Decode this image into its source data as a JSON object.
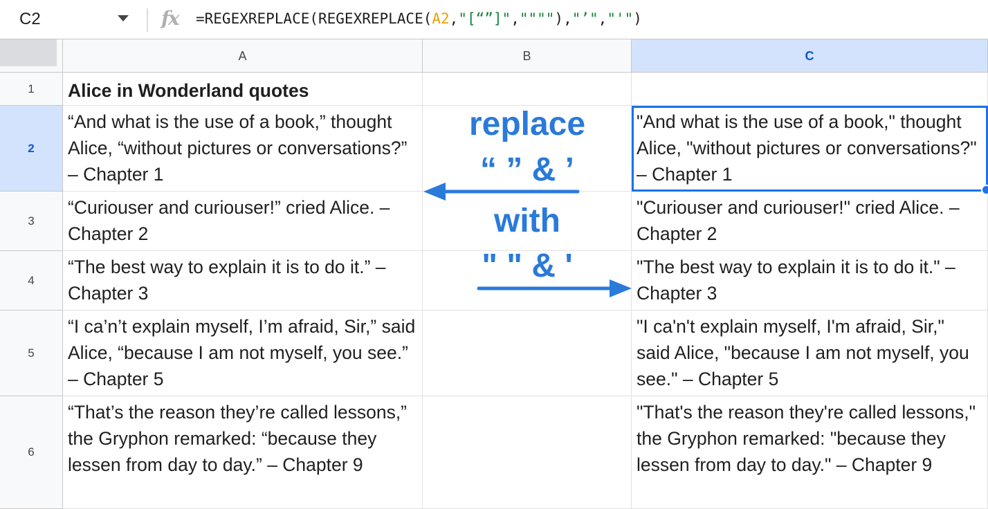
{
  "formula_bar": {
    "name_box": "C2",
    "fx_icon": "fx-icon",
    "formula_parts": [
      "=REGEXREPLACE(REGEXREPLACE(",
      "A2",
      ",",
      "\"[“”]\"",
      ",",
      "\"\"\"\"",
      "),",
      "\"’\"",
      ",",
      "\"'\"",
      ")"
    ]
  },
  "columns": [
    {
      "label": "A",
      "selected": false
    },
    {
      "label": "B",
      "selected": false
    },
    {
      "label": "C",
      "selected": true
    }
  ],
  "rows": [
    {
      "num": "1",
      "a": "Alice in Wonderland quotes",
      "c": ""
    },
    {
      "num": "2",
      "a": "“And what is the use of a book,” thought Alice, “without pictures or conversations?” – Chapter 1",
      "c": "\"And what is the use of a book,\" thought Alice, \"without pictures or conversations?\" – Chapter 1"
    },
    {
      "num": "3",
      "a": "“Curiouser and curiouser!” cried Alice. – Chapter 2",
      "c": "\"Curiouser and curiouser!\" cried Alice. – Chapter 2"
    },
    {
      "num": "4",
      "a": "“The best way to explain it is to do it.” – Chapter 3",
      "c": "\"The best way to explain it is to do it.\" – Chapter 3"
    },
    {
      "num": "5",
      "a": "“I ca’n’t explain myself, I’m afraid, Sir,” said Alice, “because I am not myself, you see.” – Chapter 5",
      "c": "\"I ca'n't explain myself, I'm afraid, Sir,\" said Alice, \"because I am not myself, you see.\" – Chapter 5"
    },
    {
      "num": "6",
      "a": "“That’s the reason they’re called lessons,” the Gryphon remarked: “because they lessen from day to day.” – Chapter 9",
      "c": "\"That's the reason they're called lessons,\" the Gryphon remarked: \"because they lessen from day to day.\" – Chapter 9"
    }
  ],
  "annotation": {
    "line1": "replace",
    "line2": "“ ” & ’",
    "line3": "with",
    "line4": "\" \" & '"
  },
  "colors": {
    "accent": "#1a73e8",
    "annotation": "#2a7ad9",
    "header_selected": "#d3e3fd"
  }
}
